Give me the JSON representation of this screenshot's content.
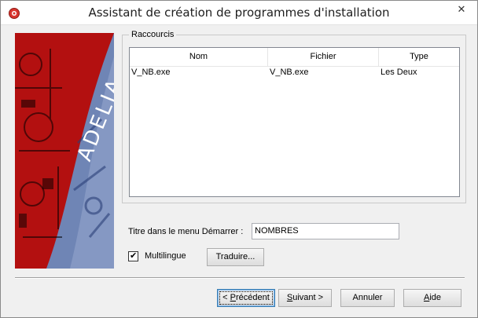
{
  "window": {
    "title": "Assistant de création de programmes d'installation",
    "close_glyph": "✕"
  },
  "banner": {
    "brand_text": "ADELIA"
  },
  "shortcuts_group": {
    "legend": "Raccourcis",
    "columns": [
      "Nom",
      "Fichier",
      "Type"
    ],
    "rows": [
      {
        "nom": "V_NB.exe",
        "fichier": "V_NB.exe",
        "type": "Les Deux"
      }
    ]
  },
  "start_menu": {
    "label": "Titre dans le menu Démarrer :",
    "value": "NOMBRES"
  },
  "multilingual": {
    "label": "Multilingue",
    "checked": true,
    "check_glyph": "✔"
  },
  "buttons": {
    "translate": "Traduire...",
    "previous_prefix": "< ",
    "previous_accel": "P",
    "previous_rest": "récédent",
    "next_accel": "S",
    "next_rest": "uivant >",
    "cancel": "Annuler",
    "help_accel": "A",
    "help_rest": "ide"
  },
  "icons": {
    "app": "app-icon",
    "close": "close-icon",
    "check": "check-icon"
  },
  "colors": {
    "banner_red": "#b31010",
    "banner_blue": "#6f85b5"
  }
}
